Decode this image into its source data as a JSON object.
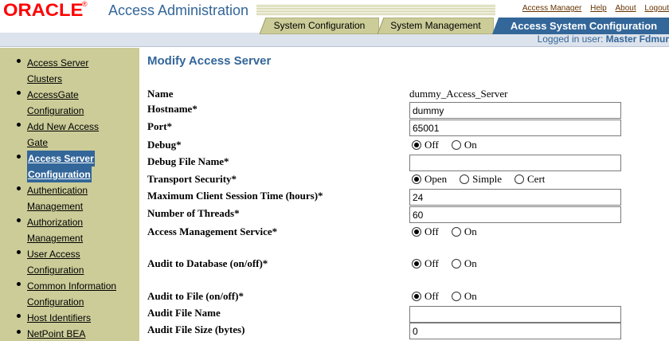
{
  "header": {
    "logo": "ORACLE",
    "logo_mark": "®",
    "app_title": "Access Administration",
    "global_links": [
      "Access Manager",
      "Help",
      "About",
      "Logout"
    ],
    "logged_in_label": "Logged in user:",
    "logged_in_user": "Master Fdmur"
  },
  "tabs": [
    {
      "label": "System Configuration",
      "active": false
    },
    {
      "label": "System Management",
      "active": false
    },
    {
      "label": "Access System Configuration",
      "active": true
    }
  ],
  "sidebar": {
    "items": [
      {
        "lines": [
          "Access Server",
          "Clusters"
        ],
        "active": false
      },
      {
        "lines": [
          "AccessGate",
          "Configuration"
        ],
        "active": false
      },
      {
        "lines": [
          "Add New Access",
          "Gate"
        ],
        "active": false
      },
      {
        "lines": [
          "Access Server",
          "Configuration"
        ],
        "active": true
      },
      {
        "lines": [
          "Authentication",
          "Management"
        ],
        "active": false
      },
      {
        "lines": [
          "Authorization",
          "Management"
        ],
        "active": false
      },
      {
        "lines": [
          "User Access",
          "Configuration"
        ],
        "active": false
      },
      {
        "lines": [
          "Common Information",
          "Configuration"
        ],
        "active": false
      },
      {
        "lines": [
          "Host Identifiers"
        ],
        "active": false
      },
      {
        "lines": [
          "NetPoint BEA"
        ],
        "active": false
      }
    ]
  },
  "main": {
    "title": "Modify Access Server",
    "fields": {
      "name": {
        "label": "Name",
        "value": "dummy_Access_Server"
      },
      "hostname": {
        "label": "Hostname*",
        "value": "dummy"
      },
      "port": {
        "label": "Port*",
        "value": "65001"
      },
      "debug": {
        "label": "Debug*",
        "options": [
          "Off",
          "On"
        ],
        "selected": "Off"
      },
      "debug_file": {
        "label": "Debug File Name*",
        "value": ""
      },
      "transport": {
        "label": "Transport Security*",
        "options": [
          "Open",
          "Simple",
          "Cert"
        ],
        "selected": "Open"
      },
      "max_session": {
        "label": "Maximum Client Session Time (hours)*",
        "value": "24"
      },
      "threads": {
        "label": "Number of Threads*",
        "value": "60"
      },
      "ams": {
        "label": "Access Management Service*",
        "options": [
          "Off",
          "On"
        ],
        "selected": "Off"
      },
      "audit_db": {
        "label": "Audit to Database (on/off)*",
        "options": [
          "Off",
          "On"
        ],
        "selected": "Off"
      },
      "audit_file": {
        "label": "Audit to File (on/off)*",
        "options": [
          "Off",
          "On"
        ],
        "selected": "Off"
      },
      "audit_file_name": {
        "label": "Audit File Name",
        "value": ""
      },
      "audit_file_size": {
        "label": "Audit File Size (bytes)",
        "value": "0"
      }
    }
  },
  "colors": {
    "brand_red": "#ff0000",
    "accent_blue": "#336699",
    "sidebar_bg": "#cccc99",
    "tab_bg": "#cccc99"
  }
}
